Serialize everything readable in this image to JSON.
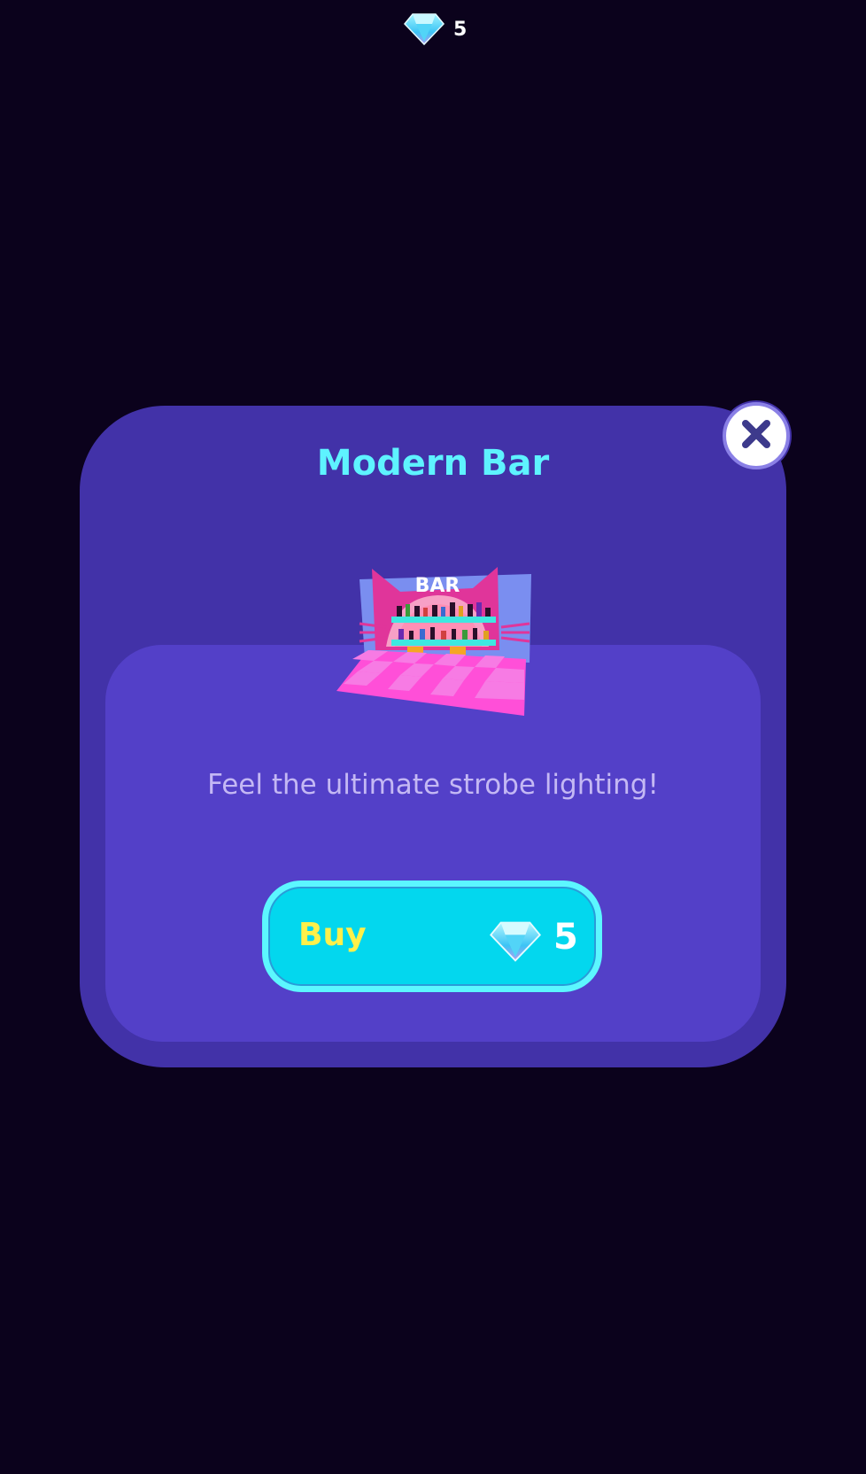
{
  "header": {
    "currency_icon": "gem-icon",
    "currency_count": "5"
  },
  "modal": {
    "title": "Modern Bar",
    "close_icon": "close-icon",
    "item_image": "modern-bar-preview",
    "item_sign_text": "BAR",
    "description": "Feel the ultimate strobe lighting!",
    "buy": {
      "label": "Buy",
      "price_icon": "gem-icon",
      "price": "5"
    }
  },
  "colors": {
    "background": "#0b021c",
    "modal": "#4232a8",
    "inner_panel": "#5340c8",
    "title": "#5ef3ff",
    "button": "#03d7ee",
    "button_border": "#5cf7ff",
    "buy_label": "#fff04a"
  }
}
